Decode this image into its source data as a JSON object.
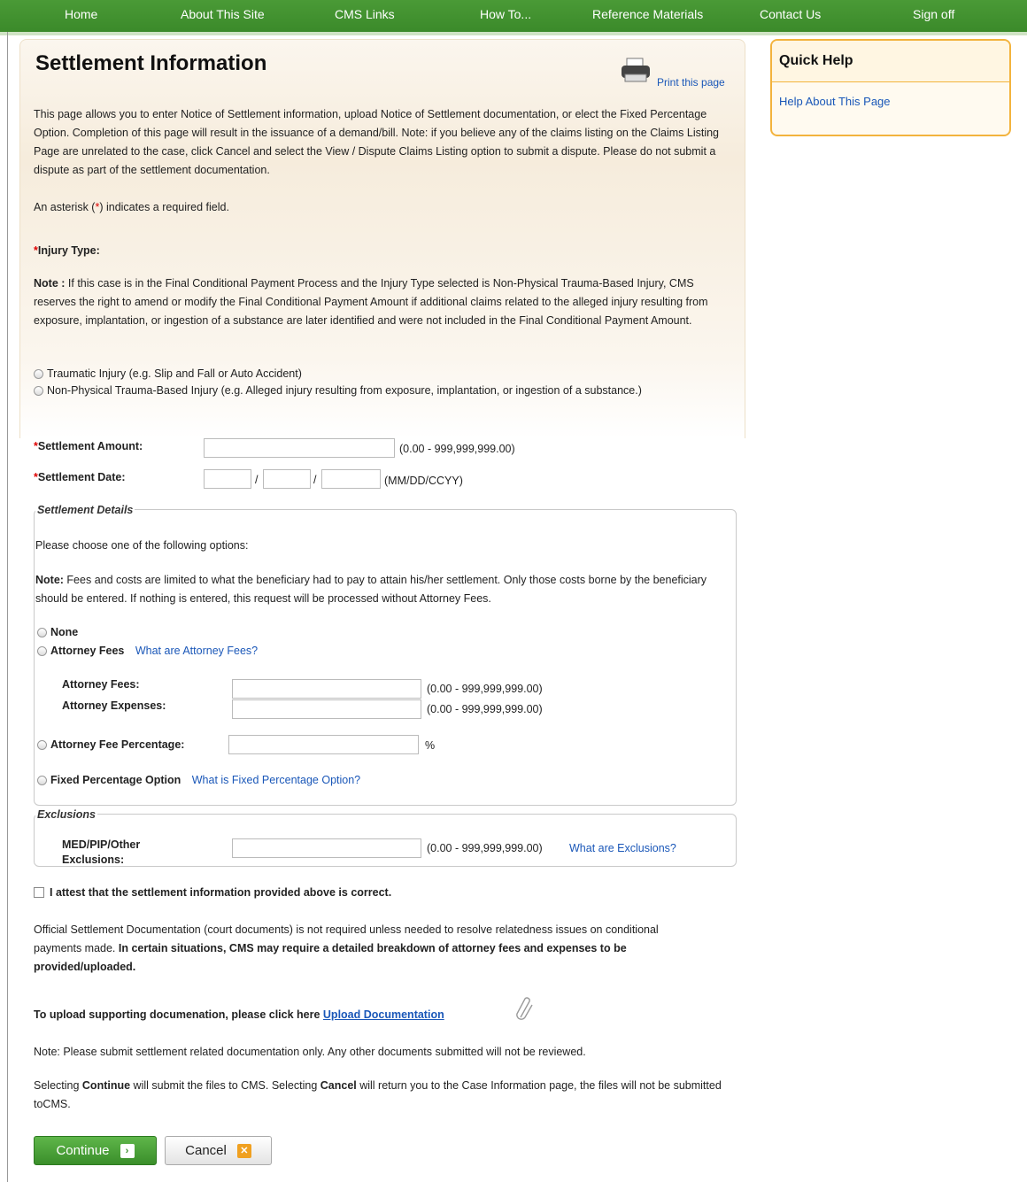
{
  "nav": {
    "items": [
      "Home",
      "About This Site",
      "CMS Links",
      "How To...",
      "Reference Materials",
      "Contact Us",
      "Sign off"
    ]
  },
  "page": {
    "title": "Settlement Information",
    "print_label": "Print this page",
    "intro": "This page allows you to enter Notice of Settlement information, upload Notice of Settlement documentation, or elect the Fixed Percentage Option. Completion of this page will result in the issuance of a demand/bill. Note: if you believe any of the claims listing on the Claims Listing Page are unrelated to the case, click Cancel and select the View / Dispute Claims Listing option to submit a dispute. Please do not submit a dispute as part of the settlement documentation.",
    "asterisk_pre": "An asterisk (",
    "asterisk_star": "*",
    "asterisk_post": ") indicates a required field."
  },
  "injury": {
    "label": "Injury Type:",
    "note_label": "Note :",
    "note_text": " If this case is in the Final Conditional Payment Process and the Injury Type selected is Non-Physical Trauma-Based Injury, CMS reserves the right to amend or modify the Final Conditional Payment Amount if additional claims related to the alleged injury resulting from exposure, implantation, or ingestion of a substance are later identified and were not included in the Final Conditional Payment Amount.",
    "option1": "Traumatic Injury (e.g. Slip and Fall or Auto Accident)",
    "option2": "Non-Physical Trauma-Based Injury (e.g. Alleged injury resulting from exposure, implantation, or ingestion of a substance.)"
  },
  "settlement": {
    "amount_label": "Settlement Amount:",
    "amount_hint": "(0.00 - 999,999,999.00)",
    "date_label": "Settlement Date:",
    "date_sep": "/",
    "date_hint": "(MM/DD/CCYY)"
  },
  "details": {
    "legend": "Settlement Details",
    "choose": "Please choose one of the following options:",
    "note_label": "Note:",
    "note_text": " Fees and costs are limited to what the beneficiary had to pay to attain his/her settlement. Only those costs borne by the beneficiary should be entered. If nothing is entered, this request will be processed without Attorney Fees.",
    "none": "None",
    "attorney_fees": "Attorney Fees",
    "attorney_fees_link": "What are Attorney Fees?",
    "fees_label": "Attorney Fees:",
    "expenses_label": "Attorney Expenses:",
    "range_hint": "(0.00 - 999,999,999.00)",
    "percentage_label": "Attorney Fee Percentage:",
    "percent_sign": "%",
    "fixed_label": "Fixed Percentage Option",
    "fixed_link": "What is Fixed Percentage Option?"
  },
  "exclusions": {
    "legend": "Exclusions",
    "label_line1": "MED/PIP/Other",
    "label_line2": "Exclusions:",
    "range_hint": "(0.00 - 999,999,999.00)",
    "link": "What are Exclusions?"
  },
  "attest": "I attest that the settlement information provided above is correct.",
  "official": {
    "text": "Official Settlement Documentation (court documents) is not required unless needed to resolve relatedness issues on conditional payments made. ",
    "bold": "In certain situations, CMS may require a detailed breakdown of attorney fees and expenses to be provided/uploaded."
  },
  "upload": {
    "text": "To upload supporting documenation, please click here ",
    "link": "Upload Documentation"
  },
  "note_docs": "Note: Please submit settlement related documentation only. Any other documents submitted will not be reviewed.",
  "selecting": {
    "p1": "Selecting ",
    "continue": "Continue",
    "p2": " will submit the files to CMS. Selecting ",
    "cancel": "Cancel",
    "p3": " will return you to the Case Information page, the files will not be submitted toCMS."
  },
  "buttons": {
    "continue": "Continue",
    "cancel": "Cancel"
  },
  "quick_help": {
    "title": "Quick Help",
    "link": "Help About This Page"
  },
  "colors": {
    "nav_green": "#3b8a2a",
    "link_blue": "#1a57b8",
    "required_red": "#dd0000",
    "help_border": "#f3b33d"
  }
}
